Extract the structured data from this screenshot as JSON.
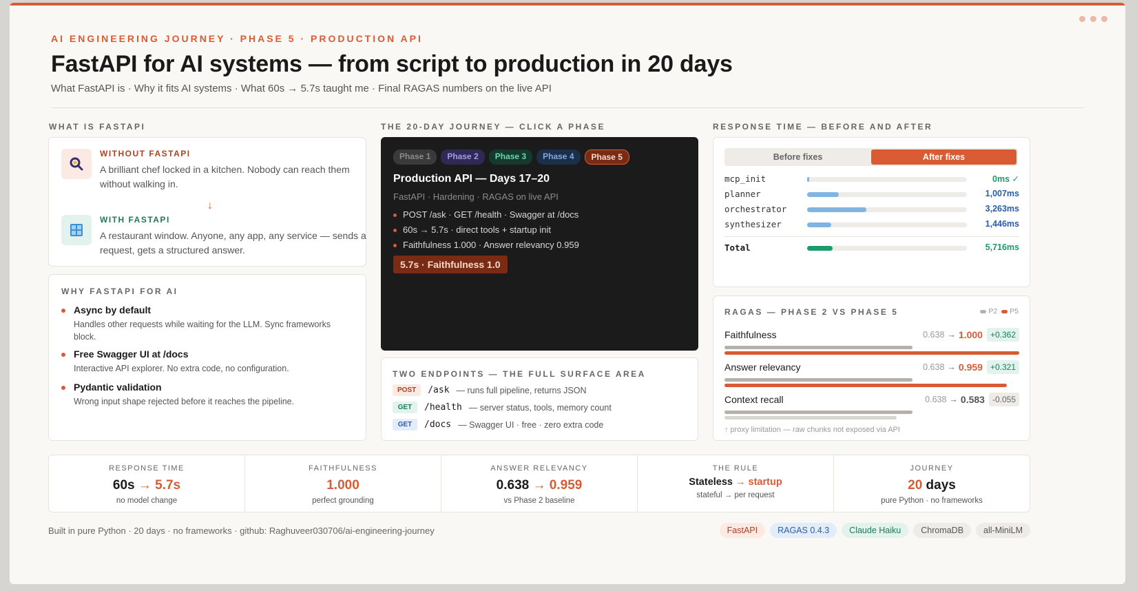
{
  "header": {
    "eyebrow": "AI ENGINEERING JOURNEY · PHASE 5 · PRODUCTION API",
    "title": "FastAPI for AI systems — from script to production in 20 days",
    "subtitle": "What FastAPI is · Why it fits AI systems · What 60s → 5.7s taught me · Final RAGAS numbers on the live API"
  },
  "what": {
    "label": "WHAT IS FASTAPI",
    "without": {
      "heading": "WITHOUT FASTAPI",
      "text": "A brilliant chef locked in a kitchen. Nobody can reach them without walking in.",
      "icon": "magnifier-icon"
    },
    "arrow": "↓",
    "with": {
      "heading": "WITH FASTAPI",
      "text": "A restaurant window. Anyone, any app, any service — sends a request, gets a structured answer.",
      "icon": "window-icon"
    }
  },
  "why": {
    "label": "WHY FASTAPI FOR AI",
    "items": [
      {
        "title": "Async by default",
        "desc": "Handles other requests while waiting for the LLM. Sync frameworks block."
      },
      {
        "title": "Free Swagger UI at /docs",
        "desc": "Interactive API explorer. No extra code, no configuration."
      },
      {
        "title": "Pydantic validation",
        "desc": "Wrong input shape rejected before it reaches the pipeline."
      }
    ]
  },
  "journey": {
    "label": "THE 20-DAY JOURNEY — CLICK A PHASE",
    "phases": [
      "Phase 1",
      "Phase 2",
      "Phase 3",
      "Phase 4",
      "Phase 5"
    ],
    "active": {
      "title": "Production API — Days 17–20",
      "sub": "FastAPI · Hardening · RAGAS on live API",
      "points": [
        "POST /ask · GET /health · Swagger at /docs",
        "60s → 5.7s · direct tools + startup init",
        "Faithfulness 1.000 · Answer relevancy 0.959"
      ],
      "badge": "5.7s · Faithfulness 1.0"
    }
  },
  "endpoints": {
    "label": "TWO ENDPOINTS — THE FULL SURFACE AREA",
    "rows": [
      {
        "method": "POST",
        "path": "/ask",
        "desc": "— runs full pipeline, returns JSON"
      },
      {
        "method": "GET",
        "path": "/health",
        "desc": "— server status, tools, memory count"
      },
      {
        "method": "GET",
        "path": "/docs",
        "desc": "— Swagger UI · free · zero extra code"
      }
    ]
  },
  "response": {
    "label": "RESPONSE TIME — BEFORE AND AFTER",
    "tabs": {
      "before": "Before fixes",
      "after": "After fixes"
    },
    "rows": [
      {
        "name": "mcp_init",
        "value": "0ms ✓",
        "fraction": 0.005
      },
      {
        "name": "planner",
        "value": "1,007ms",
        "fraction": 0.2
      },
      {
        "name": "orchestrator",
        "value": "3,263ms",
        "fraction": 0.37
      },
      {
        "name": "synthesizer",
        "value": "1,446ms",
        "fraction": 0.15
      }
    ],
    "total": {
      "name": "Total",
      "value": "5,716ms",
      "fraction": 0.16
    }
  },
  "ragas": {
    "label": "RAGAS — PHASE 2 VS PHASE 5",
    "legend": [
      "P2",
      "P5"
    ],
    "rows": [
      {
        "name": "Faithfulness",
        "p2": "0.638",
        "p5": "1.000",
        "delta": "+0.362",
        "p2_value": 0.638,
        "p5_value": 1.0
      },
      {
        "name": "Answer relevancy",
        "p2": "0.638",
        "p5": "0.959",
        "delta": "+0.321",
        "p2_value": 0.638,
        "p5_value": 0.959
      },
      {
        "name": "Context recall",
        "p2": "0.638",
        "p5": "0.583",
        "delta": "-0.055",
        "p2_value": 0.638,
        "p5_value": 0.583
      }
    ],
    "note": "↑ proxy limitation — raw chunks not exposed via API"
  },
  "stats": [
    {
      "label": "RESPONSE TIME",
      "a": "60s",
      "b": "→ 5.7s",
      "sub": "no model change"
    },
    {
      "label": "FAITHFULNESS",
      "a": "",
      "b": "1.000",
      "sub": "perfect grounding"
    },
    {
      "label": "ANSWER RELEVANCY",
      "a": "0.638",
      "b": "→ 0.959",
      "sub": "vs Phase 2 baseline"
    },
    {
      "label": "THE RULE",
      "a": "Stateless",
      "b": "→ startup",
      "sub": "stateful → per request"
    },
    {
      "label": "JOURNEY",
      "a": "20",
      "b": "days",
      "sub": "pure Python · no frameworks"
    }
  ],
  "footer": {
    "text": "Built in pure Python · 20 days · no frameworks · github: Raghuveer030706/ai-engineering-journey",
    "chips": [
      "FastAPI",
      "RAGAS 0.4.3",
      "Claude Haiku",
      "ChromaDB",
      "all-MiniLM"
    ]
  },
  "colors": {
    "accent": "#d95b33",
    "green": "#1e9a6c",
    "blue": "#2a5da8"
  }
}
